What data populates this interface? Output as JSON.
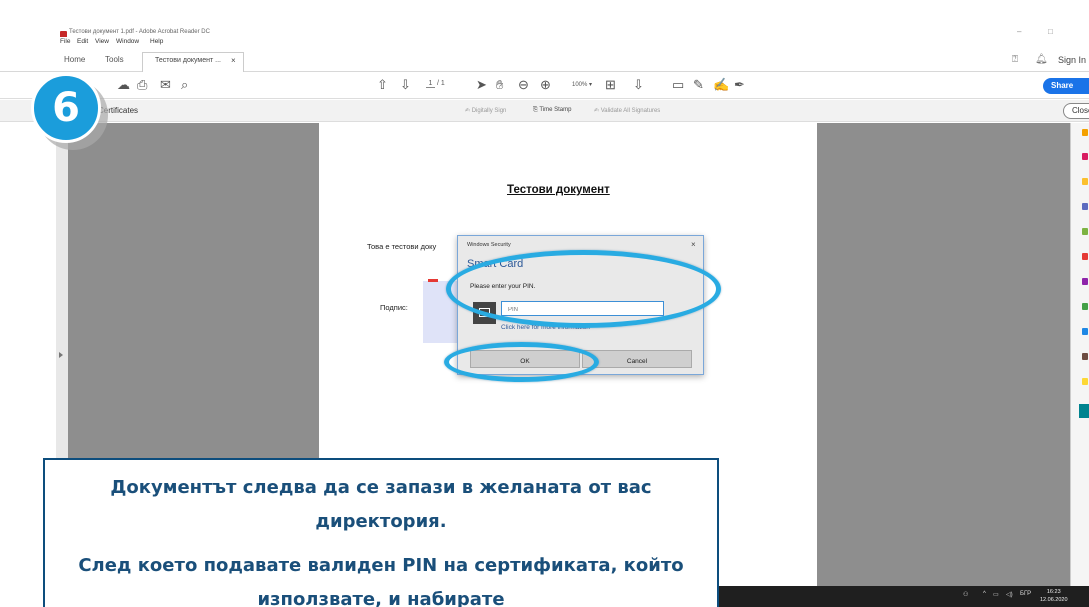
{
  "window": {
    "title": "Тестови документ 1.pdf - Adobe Acrobat Reader DC",
    "minimize_glyph": "–",
    "maximize_glyph": "□"
  },
  "menu": [
    "File",
    "Edit",
    "View",
    "Window",
    "Help"
  ],
  "tabs": {
    "home": "Home",
    "tools": "Tools",
    "document": "Тестови документ ...",
    "document_close": "×",
    "sign_in": "Sign In"
  },
  "toolbar": {
    "page_current": "1",
    "page_total": "/ 1",
    "zoom": "100%"
  },
  "share_button": "Share",
  "certificates_bar": {
    "title": "Certificates",
    "digitally_sign": "Digitally Sign",
    "time_stamp": "Time Stamp",
    "validate_all": "Validate All Signatures",
    "close": "Close"
  },
  "document": {
    "title": "Тестови документ",
    "body": "Това е тестови доку",
    "signature_label": "Подпис:"
  },
  "dialog": {
    "caption": "Windows Security",
    "close": "×",
    "heading": "Smart Card",
    "prompt": "Please enter your PIN.",
    "pin_placeholder": "PIN",
    "more_info": "Click here for more information",
    "ok": "OK",
    "cancel": "Cancel"
  },
  "taskbar": {
    "language": "БГР",
    "time": "16:23",
    "date": "12.06.2020"
  },
  "step_number": "6",
  "callout": {
    "line1": "Документът следва да се запази в желаната от вас директория.",
    "line2": "След което подавате валиден PIN на сертификата, който използвате, и набирате"
  },
  "colors": {
    "accent": "#1b9ddb",
    "highlight": "#29abe2",
    "share": "#1a73e8",
    "callout_text": "#1a4f7a"
  }
}
